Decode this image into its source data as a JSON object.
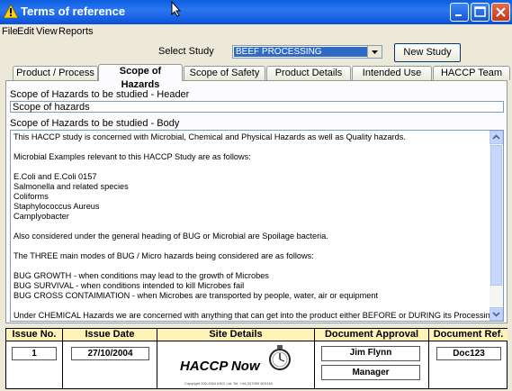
{
  "window": {
    "title": "Terms of reference"
  },
  "menu": [
    "File",
    "Edit",
    "View",
    "Reports"
  ],
  "study": {
    "label": "Select Study",
    "selected": "BEEF PROCESSING",
    "new_button": "New Study"
  },
  "tabs": [
    "Product / Process",
    "Scope of Hazards",
    "Scope of Safety",
    "Product Details",
    "Intended Use",
    "HACCP Team"
  ],
  "active_tab": "Scope of Hazards",
  "header_section": {
    "label": "Scope of Hazards to be studied - Header",
    "value": "Scope of hazards"
  },
  "body_section": {
    "label": "Scope of Hazards to be studied - Body",
    "paragraphs": [
      "This HACCP study is concerned with Microbial, Chemical and Physical Hazards as well as Quality hazards.",
      "Microbial Examples relevant to this HACCP Study are as follows:",
      "E.Coli and E.Coli 0157\nSalmonella and related species\nColiforms\nStaphylococcus Aureus\nCamplyobacter",
      "Also considered under the general heading of BUG or Microbial are Spoilage bacteria.",
      "The THREE main modes of BUG / Micro hazards being considered are as follows:",
      "BUG GROWTH - when conditions may lead to the growth of Microbes\nBUG SURVIVAL - when conditions intended to kill Microbes fail\nBUG CROSS CONTAIMIATION - when Microbes are transported by people, water, air or equipment",
      "Under CHEMICAL Hazards we are concerned with anything that can get into the product either BEFORE or DURING its Processing,"
    ]
  },
  "footer": {
    "issue_no": {
      "label": "Issue No.",
      "value": "1"
    },
    "issue_date": {
      "label": "Issue Date",
      "value": "27/10/2004"
    },
    "site_details": {
      "label": "Site Details",
      "logo": "HACCP Now",
      "copyright": "Copyright 200-2004 ASCI Ltd. Tel. +44 (0)7990 503148"
    },
    "approval": {
      "label": "Document Approval",
      "name": "Jim Flynn",
      "role": "Manager"
    },
    "doc_ref": {
      "label": "Document Ref.",
      "value": "Doc123"
    }
  },
  "icons": {
    "window": "warning-icon",
    "cursor": "mouse-pointer-icon",
    "logo": "stopwatch-icon"
  },
  "colors": {
    "titlebar": "#0a5ee0",
    "selection": "#316ac5",
    "header_bg": "#fff3b6"
  }
}
